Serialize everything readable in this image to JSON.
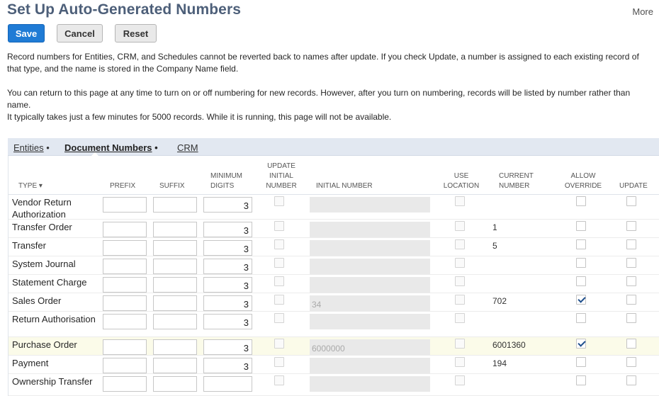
{
  "page": {
    "title": "Set Up Auto-Generated Numbers",
    "more_label": "More"
  },
  "buttons": {
    "save": "Save",
    "cancel": "Cancel",
    "reset": "Reset"
  },
  "info": {
    "p1": "Record numbers for Entities, CRM, and Schedules cannot be reverted back to names after update. If you check Update, a number is assigned to each existing record of that type, and the name is stored in the Company Name field.",
    "p2": "You can return to this page at any time to turn on or off numbering for new records. However, after you turn on numbering, records will be listed by number rather than name.",
    "p3": "It typically takes just a few minutes for 5000 records. While it is running, this page will not be available."
  },
  "tabs": {
    "entities": "Entities",
    "document_numbers": "Document Numbers",
    "crm": "CRM",
    "bullet": "•",
    "active": "document_numbers"
  },
  "columns": {
    "type": "TYPE ▾",
    "prefix": "PREFIX",
    "suffix": "SUFFIX",
    "min_digits_1": "MINIMUM",
    "min_digits_2": "DIGITS",
    "update_initial_1": "UPDATE",
    "update_initial_2": "INITIAL",
    "update_initial_3": "NUMBER",
    "initial_number": "INITIAL NUMBER",
    "use_location_1": "USE",
    "use_location_2": "LOCATION",
    "current_number_1": "CURRENT",
    "current_number_2": "NUMBER",
    "allow_override_1": "ALLOW",
    "allow_override_2": "OVERRIDE",
    "update": "UPDATE"
  },
  "rows": [
    {
      "type": "Vendor Return Authorization",
      "prefix": "",
      "suffix": "",
      "min_digits": "3",
      "initial_number": "",
      "current_number": "",
      "allow_override": false,
      "highlight": false
    },
    {
      "type": "Transfer Order",
      "prefix": "",
      "suffix": "",
      "min_digits": "3",
      "initial_number": "",
      "current_number": "1",
      "allow_override": false,
      "highlight": false
    },
    {
      "type": "Transfer",
      "prefix": "",
      "suffix": "",
      "min_digits": "3",
      "initial_number": "",
      "current_number": "5",
      "allow_override": false,
      "highlight": false
    },
    {
      "type": "System Journal",
      "prefix": "",
      "suffix": "",
      "min_digits": "3",
      "initial_number": "",
      "current_number": "",
      "allow_override": false,
      "highlight": false
    },
    {
      "type": "Statement Charge",
      "prefix": "",
      "suffix": "",
      "min_digits": "3",
      "initial_number": "",
      "current_number": "",
      "allow_override": false,
      "highlight": false
    },
    {
      "type": "Sales Order",
      "prefix": "",
      "suffix": "",
      "min_digits": "3",
      "initial_number": "34",
      "current_number": "702",
      "allow_override": true,
      "highlight": false
    },
    {
      "type": "Return Authorisation",
      "prefix": "",
      "suffix": "",
      "min_digits": "3",
      "initial_number": "",
      "current_number": "",
      "allow_override": false,
      "highlight": false
    },
    {
      "type": "Purchase Order",
      "prefix": "",
      "suffix": "",
      "min_digits": "3",
      "initial_number": "6000000",
      "current_number": "6001360",
      "allow_override": true,
      "highlight": true
    },
    {
      "type": "Payment",
      "prefix": "",
      "suffix": "",
      "min_digits": "3",
      "initial_number": "",
      "current_number": "194",
      "allow_override": false,
      "highlight": false
    },
    {
      "type": "Ownership Transfer",
      "prefix": "",
      "suffix": "",
      "min_digits": "",
      "initial_number": "",
      "current_number": "",
      "allow_override": false,
      "highlight": false
    }
  ]
}
